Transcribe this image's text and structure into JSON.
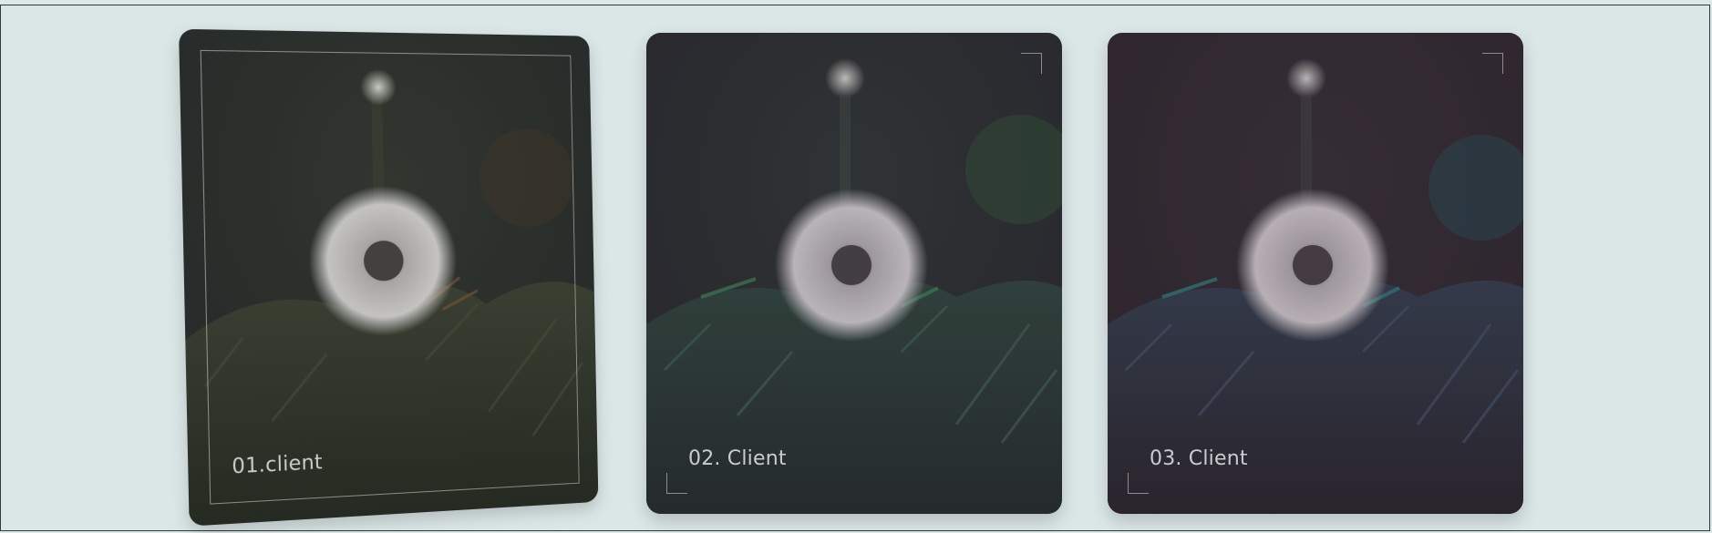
{
  "cards": [
    {
      "label": "01.client",
      "tint": "#3a3a33"
    },
    {
      "label": "02. Client",
      "tint": "#3a3040"
    },
    {
      "label": "03. Client",
      "tint": "#40303a"
    }
  ]
}
